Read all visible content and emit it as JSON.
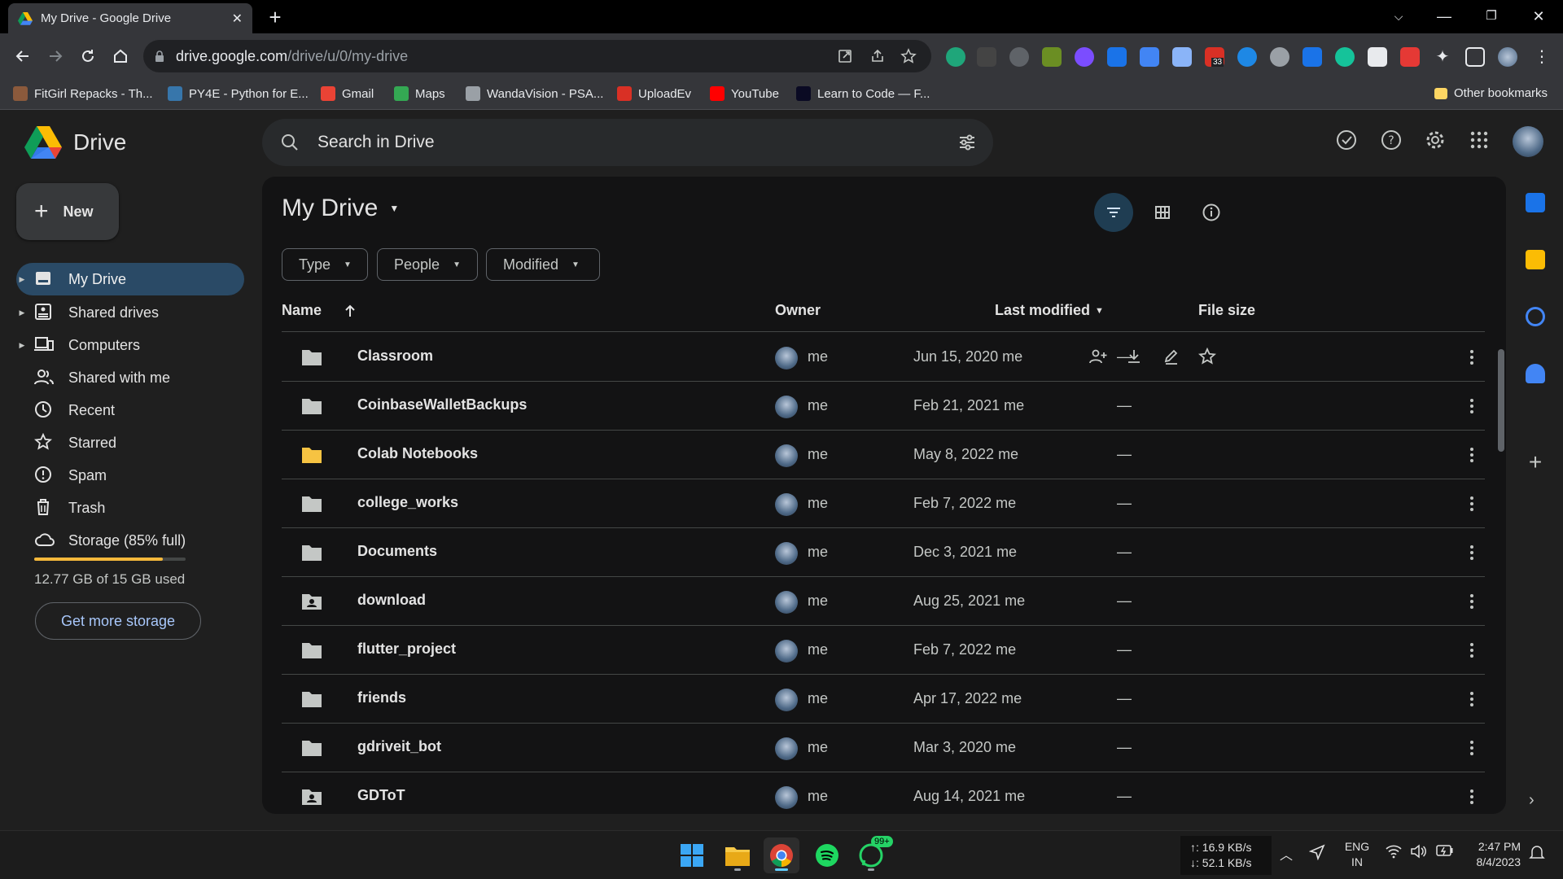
{
  "browser": {
    "tab_title": "My Drive - Google Drive",
    "new_tab": "+",
    "url_host": "drive.google.com",
    "url_path": "/drive/u/0/my-drive",
    "bookmarks": [
      {
        "label": "FitGirl Repacks - Th...",
        "color": "#8b5a3c"
      },
      {
        "label": "PY4E - Python for E...",
        "color": "#3776ab"
      },
      {
        "label": "Gmail",
        "color": "#ea4335"
      },
      {
        "label": "Maps",
        "color": "#34a853"
      },
      {
        "label": "WandaVision - PSA...",
        "color": "#9aa0a6"
      },
      {
        "label": "UploadEv",
        "color": "#d93025"
      },
      {
        "label": "YouTube",
        "color": "#ff0000"
      },
      {
        "label": "Learn to Code — F...",
        "color": "#0a0a23"
      }
    ],
    "other_bookmarks": "Other bookmarks",
    "ext_badge": "33"
  },
  "drive": {
    "app_name": "Drive",
    "search_placeholder": "Search in Drive",
    "new_label": "New",
    "nav": [
      {
        "label": "My Drive",
        "icon": "my-drive-icon",
        "active": true,
        "caret": true
      },
      {
        "label": "Shared drives",
        "icon": "shared-drives-icon",
        "active": false,
        "caret": true
      },
      {
        "label": "Computers",
        "icon": "computers-icon",
        "active": false,
        "caret": true
      },
      {
        "label": "Shared with me",
        "icon": "shared-with-me-icon",
        "active": false,
        "caret": false
      },
      {
        "label": "Recent",
        "icon": "recent-icon",
        "active": false,
        "caret": false
      },
      {
        "label": "Starred",
        "icon": "star-icon",
        "active": false,
        "caret": false
      },
      {
        "label": "Spam",
        "icon": "spam-icon",
        "active": false,
        "caret": false
      },
      {
        "label": "Trash",
        "icon": "trash-icon",
        "active": false,
        "caret": false
      },
      {
        "label": "Storage (85% full)",
        "icon": "cloud-icon",
        "active": false,
        "caret": false
      }
    ],
    "storage_used_fraction": 0.85,
    "storage_text": "12.77 GB of 15 GB used",
    "get_more_storage": "Get more storage",
    "main_title": "My Drive",
    "filters": [
      "Type",
      "People",
      "Modified"
    ],
    "columns": {
      "name": "Name",
      "owner": "Owner",
      "modified": "Last modified",
      "size": "File size"
    },
    "files": [
      {
        "name": "Classroom",
        "owner": "me",
        "modified": "Jun 15, 2020 me",
        "size": "—",
        "icon": "folder-icon",
        "color": "#c4c7c5",
        "hover": true
      },
      {
        "name": "CoinbaseWalletBackups",
        "owner": "me",
        "modified": "Feb 21, 2021 me",
        "size": "—",
        "icon": "folder-icon",
        "color": "#c4c7c5"
      },
      {
        "name": "Colab Notebooks",
        "owner": "me",
        "modified": "May 8, 2022 me",
        "size": "—",
        "icon": "folder-icon",
        "color": "#f6c342"
      },
      {
        "name": "college_works",
        "owner": "me",
        "modified": "Feb 7, 2022 me",
        "size": "—",
        "icon": "folder-icon",
        "color": "#c4c7c5"
      },
      {
        "name": "Documents",
        "owner": "me",
        "modified": "Dec 3, 2021 me",
        "size": "—",
        "icon": "folder-icon",
        "color": "#c4c7c5"
      },
      {
        "name": "download",
        "owner": "me",
        "modified": "Aug 25, 2021 me",
        "size": "—",
        "icon": "shared-folder-icon",
        "color": "#c4c7c5"
      },
      {
        "name": "flutter_project",
        "owner": "me",
        "modified": "Feb 7, 2022 me",
        "size": "—",
        "icon": "folder-icon",
        "color": "#c4c7c5"
      },
      {
        "name": "friends",
        "owner": "me",
        "modified": "Apr 17, 2022 me",
        "size": "—",
        "icon": "folder-icon",
        "color": "#c4c7c5"
      },
      {
        "name": "gdriveit_bot",
        "owner": "me",
        "modified": "Mar 3, 2020 me",
        "size": "—",
        "icon": "folder-icon",
        "color": "#c4c7c5"
      },
      {
        "name": "GDToT",
        "owner": "me",
        "modified": "Aug 14, 2021 me",
        "size": "—",
        "icon": "shared-folder-icon",
        "color": "#c4c7c5"
      }
    ],
    "accent": "#a8c7fa"
  },
  "taskbar": {
    "net_up": "↑: 16.9 KB/s",
    "net_down": "↓: 52.1 KB/s",
    "lang_top": "ENG",
    "lang_bottom": "IN",
    "time": "2:47 PM",
    "date": "8/4/2023",
    "whatsapp_badge": "99+"
  }
}
